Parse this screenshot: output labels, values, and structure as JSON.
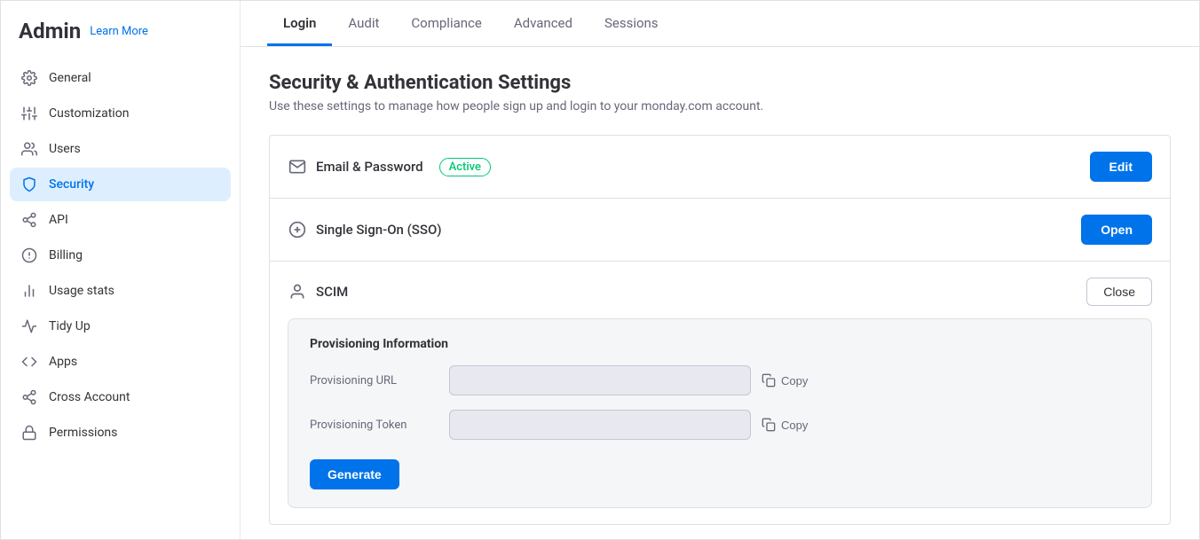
{
  "sidebar": {
    "title": "Admin",
    "learn_more": "Learn More",
    "items": [
      {
        "id": "general",
        "label": "General",
        "icon": "gear"
      },
      {
        "id": "customization",
        "label": "Customization",
        "icon": "sliders"
      },
      {
        "id": "users",
        "label": "Users",
        "icon": "users"
      },
      {
        "id": "security",
        "label": "Security",
        "icon": "shield",
        "active": true
      },
      {
        "id": "api",
        "label": "API",
        "icon": "api"
      },
      {
        "id": "billing",
        "label": "Billing",
        "icon": "dollar"
      },
      {
        "id": "usage-stats",
        "label": "Usage stats",
        "icon": "bar-chart"
      },
      {
        "id": "tidy-up",
        "label": "Tidy Up",
        "icon": "tidy"
      },
      {
        "id": "apps",
        "label": "Apps",
        "icon": "code"
      },
      {
        "id": "cross-account",
        "label": "Cross Account",
        "icon": "cross"
      },
      {
        "id": "permissions",
        "label": "Permissions",
        "icon": "lock"
      }
    ]
  },
  "tabs": [
    {
      "id": "login",
      "label": "Login",
      "active": true
    },
    {
      "id": "audit",
      "label": "Audit"
    },
    {
      "id": "compliance",
      "label": "Compliance"
    },
    {
      "id": "advanced",
      "label": "Advanced"
    },
    {
      "id": "sessions",
      "label": "Sessions"
    }
  ],
  "page": {
    "title": "Security & Authentication Settings",
    "subtitle": "Use these settings to manage how people sign up and login to your monday.com account."
  },
  "sections": {
    "email_password": {
      "label": "Email & Password",
      "badge": "Active",
      "button": "Edit"
    },
    "sso": {
      "label": "Single Sign-On (SSO)",
      "button": "Open"
    },
    "scim": {
      "label": "SCIM",
      "button": "Close",
      "provisioning_info": {
        "title": "Provisioning Information",
        "provisioning_url": {
          "label": "Provisioning URL",
          "value": "",
          "placeholder": "",
          "copy_label": "Copy"
        },
        "provisioning_token": {
          "label": "Provisioning Token",
          "value": "",
          "placeholder": "",
          "copy_label": "Copy"
        },
        "generate_button": "Generate"
      }
    }
  }
}
